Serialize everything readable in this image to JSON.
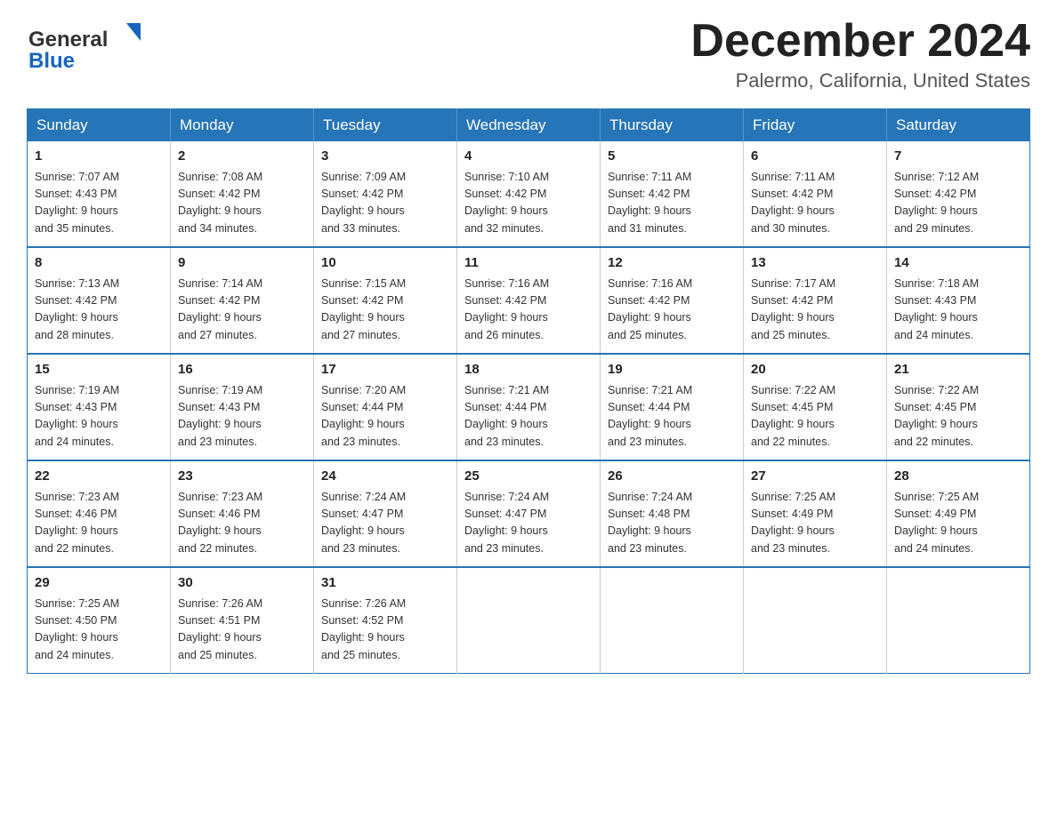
{
  "header": {
    "logo_general": "General",
    "logo_blue": "Blue",
    "month_year": "December 2024",
    "location": "Palermo, California, United States"
  },
  "weekdays": [
    "Sunday",
    "Monday",
    "Tuesday",
    "Wednesday",
    "Thursday",
    "Friday",
    "Saturday"
  ],
  "weeks": [
    [
      {
        "day": "1",
        "sunrise": "7:07 AM",
        "sunset": "4:43 PM",
        "daylight": "9 hours and 35 minutes."
      },
      {
        "day": "2",
        "sunrise": "7:08 AM",
        "sunset": "4:42 PM",
        "daylight": "9 hours and 34 minutes."
      },
      {
        "day": "3",
        "sunrise": "7:09 AM",
        "sunset": "4:42 PM",
        "daylight": "9 hours and 33 minutes."
      },
      {
        "day": "4",
        "sunrise": "7:10 AM",
        "sunset": "4:42 PM",
        "daylight": "9 hours and 32 minutes."
      },
      {
        "day": "5",
        "sunrise": "7:11 AM",
        "sunset": "4:42 PM",
        "daylight": "9 hours and 31 minutes."
      },
      {
        "day": "6",
        "sunrise": "7:11 AM",
        "sunset": "4:42 PM",
        "daylight": "9 hours and 30 minutes."
      },
      {
        "day": "7",
        "sunrise": "7:12 AM",
        "sunset": "4:42 PM",
        "daylight": "9 hours and 29 minutes."
      }
    ],
    [
      {
        "day": "8",
        "sunrise": "7:13 AM",
        "sunset": "4:42 PM",
        "daylight": "9 hours and 28 minutes."
      },
      {
        "day": "9",
        "sunrise": "7:14 AM",
        "sunset": "4:42 PM",
        "daylight": "9 hours and 27 minutes."
      },
      {
        "day": "10",
        "sunrise": "7:15 AM",
        "sunset": "4:42 PM",
        "daylight": "9 hours and 27 minutes."
      },
      {
        "day": "11",
        "sunrise": "7:16 AM",
        "sunset": "4:42 PM",
        "daylight": "9 hours and 26 minutes."
      },
      {
        "day": "12",
        "sunrise": "7:16 AM",
        "sunset": "4:42 PM",
        "daylight": "9 hours and 25 minutes."
      },
      {
        "day": "13",
        "sunrise": "7:17 AM",
        "sunset": "4:42 PM",
        "daylight": "9 hours and 25 minutes."
      },
      {
        "day": "14",
        "sunrise": "7:18 AM",
        "sunset": "4:43 PM",
        "daylight": "9 hours and 24 minutes."
      }
    ],
    [
      {
        "day": "15",
        "sunrise": "7:19 AM",
        "sunset": "4:43 PM",
        "daylight": "9 hours and 24 minutes."
      },
      {
        "day": "16",
        "sunrise": "7:19 AM",
        "sunset": "4:43 PM",
        "daylight": "9 hours and 23 minutes."
      },
      {
        "day": "17",
        "sunrise": "7:20 AM",
        "sunset": "4:44 PM",
        "daylight": "9 hours and 23 minutes."
      },
      {
        "day": "18",
        "sunrise": "7:21 AM",
        "sunset": "4:44 PM",
        "daylight": "9 hours and 23 minutes."
      },
      {
        "day": "19",
        "sunrise": "7:21 AM",
        "sunset": "4:44 PM",
        "daylight": "9 hours and 23 minutes."
      },
      {
        "day": "20",
        "sunrise": "7:22 AM",
        "sunset": "4:45 PM",
        "daylight": "9 hours and 22 minutes."
      },
      {
        "day": "21",
        "sunrise": "7:22 AM",
        "sunset": "4:45 PM",
        "daylight": "9 hours and 22 minutes."
      }
    ],
    [
      {
        "day": "22",
        "sunrise": "7:23 AM",
        "sunset": "4:46 PM",
        "daylight": "9 hours and 22 minutes."
      },
      {
        "day": "23",
        "sunrise": "7:23 AM",
        "sunset": "4:46 PM",
        "daylight": "9 hours and 22 minutes."
      },
      {
        "day": "24",
        "sunrise": "7:24 AM",
        "sunset": "4:47 PM",
        "daylight": "9 hours and 23 minutes."
      },
      {
        "day": "25",
        "sunrise": "7:24 AM",
        "sunset": "4:47 PM",
        "daylight": "9 hours and 23 minutes."
      },
      {
        "day": "26",
        "sunrise": "7:24 AM",
        "sunset": "4:48 PM",
        "daylight": "9 hours and 23 minutes."
      },
      {
        "day": "27",
        "sunrise": "7:25 AM",
        "sunset": "4:49 PM",
        "daylight": "9 hours and 23 minutes."
      },
      {
        "day": "28",
        "sunrise": "7:25 AM",
        "sunset": "4:49 PM",
        "daylight": "9 hours and 24 minutes."
      }
    ],
    [
      {
        "day": "29",
        "sunrise": "7:25 AM",
        "sunset": "4:50 PM",
        "daylight": "9 hours and 24 minutes."
      },
      {
        "day": "30",
        "sunrise": "7:26 AM",
        "sunset": "4:51 PM",
        "daylight": "9 hours and 25 minutes."
      },
      {
        "day": "31",
        "sunrise": "7:26 AM",
        "sunset": "4:52 PM",
        "daylight": "9 hours and 25 minutes."
      },
      null,
      null,
      null,
      null
    ]
  ],
  "labels": {
    "sunrise": "Sunrise:",
    "sunset": "Sunset:",
    "daylight": "Daylight:"
  }
}
